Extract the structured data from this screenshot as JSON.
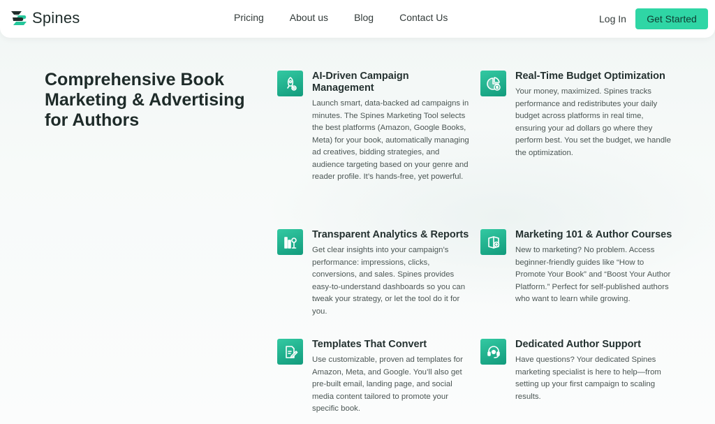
{
  "header": {
    "brand": "Spines",
    "nav": [
      "Pricing",
      "About us",
      "Blog",
      "Contact Us"
    ],
    "login": "Log In",
    "cta": "Get Started"
  },
  "hero": {
    "title": "Comprehensive Book Marketing & Advertising for Authors"
  },
  "features": [
    {
      "icon": "rocket-gear-icon",
      "title": "AI-Driven Campaign Management",
      "desc": "Launch smart, data-backed ad campaigns in minutes. The Spines Marketing Tool selects the best platforms (Amazon, Google Books, Meta) for your book, automatically managing ad creatives, bidding strategies, and audience targeting based on your genre and reader profile. It’s hands-free, yet powerful."
    },
    {
      "icon": "pie-chart-dollar-icon",
      "title": "Real-Time Budget Optimization",
      "desc": "Your money, maximized. Spines tracks performance and redistributes your daily budget across platforms in real time, ensuring your ad dollars go where they perform best. You set the budget, we handle the optimization."
    },
    {
      "icon": "analytics-bars-icon",
      "title": "Transparent Analytics & Reports",
      "desc": "Get clear insights into your campaign’s performance: impressions, clicks, conversions, and sales. Spines provides easy-to-understand dashboards so you can tweak your strategy, or let the tool do it for you."
    },
    {
      "icon": "course-book-icon",
      "title": "Marketing 101 & Author Courses",
      "desc": "New to marketing? No problem. Access beginner-friendly guides like “How to Promote Your Book” and “Boost Your Author Platform.” Perfect for self-published authors who want to learn while growing."
    },
    {
      "icon": "template-edit-icon",
      "title": "Templates That Convert",
      "desc": "Use customizable, proven ad templates for Amazon, Meta, and Google. You’ll also get pre-built email, landing page, and social media content tailored to promote your specific book."
    },
    {
      "icon": "headset-support-icon",
      "title": "Dedicated Author Support",
      "desc": "Have questions? Your dedicated Spines marketing specialist is here to help—from setting up your first campaign to scaling results."
    }
  ],
  "colors": {
    "accent": "#2fd6a5",
    "icon_tile": "#1aa985",
    "heading": "#1e2b29",
    "body_text": "#4b5654"
  }
}
